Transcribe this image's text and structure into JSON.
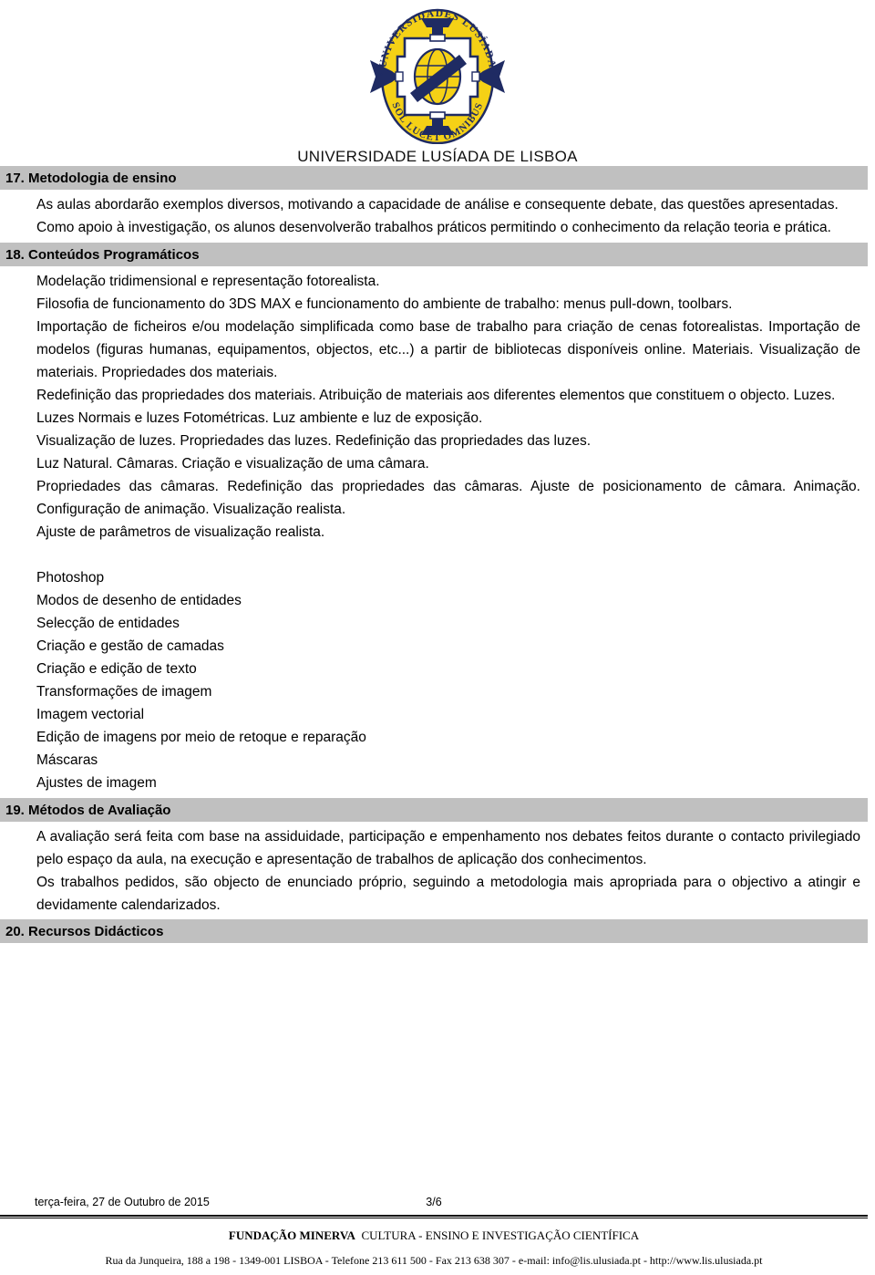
{
  "header": {
    "logo": {
      "icon": "university-seal-logo",
      "top_arc_text": "UNIVERSIDADES LUSÍADA",
      "bottom_arc_text": "SOL LUCET OMNIBUS",
      "ring_color": "#F5D116",
      "emblem_color": "#1F2B63"
    },
    "org_title": "UNIVERSIDADE LUSÍADA DE LISBOA"
  },
  "sections": [
    {
      "band_label": "17. Metodologia de ensino",
      "paragraphs": [
        "As aulas abordarão exemplos diversos, motivando a capacidade de análise e consequente debate, das questões apresentadas.",
        "Como apoio à investigação, os alunos desenvolverão trabalhos práticos permitindo o conhecimento da relação teoria e prática."
      ]
    },
    {
      "band_label": "18. Conteúdos Programáticos",
      "paragraphs": [
        "Modelação tridimensional e representação fotorealista.",
        "Filosofia de funcionamento do 3DS MAX e funcionamento do ambiente de trabalho: menus pull-down, toolbars.",
        "Importação de ficheiros e/ou modelação simplificada como base de trabalho para criação de cenas fotorealistas. Importação de modelos (figuras humanas, equipamentos, objectos, etc...) a partir de bibliotecas disponíveis online. Materiais. Visualização de materiais. Propriedades dos materiais.",
        "Redefinição das propriedades dos materiais. Atribuição de materiais aos diferentes elementos que constituem o objecto. Luzes.",
        "Luzes Normais e luzes Fotométricas. Luz ambiente e luz de exposição.",
        "Visualização de luzes. Propriedades das luzes. Redefinição das propriedades das luzes.",
        "Luz Natural. Câmaras. Criação e visualização de uma câmara.",
        "Propriedades das câmaras. Redefinição das propriedades das câmaras. Ajuste de posicionamento de câmara. Animação. Configuração de animação. Visualização realista.",
        "Ajuste de parâmetros de visualização realista."
      ],
      "list_items": [
        "Photoshop",
        "Modos de desenho de entidades",
        "Selecção de entidades",
        "Criação e gestão de camadas",
        "Criação e edição de texto",
        "Transformações de imagem",
        "Imagem vectorial",
        "Edição de imagens por meio de retoque e reparação",
        "Máscaras",
        "Ajustes de imagem"
      ]
    },
    {
      "band_label": "19. Métodos de Avaliação",
      "paragraphs": [
        "A avaliação será feita com base na assiduidade, participação e empenhamento nos debates feitos durante o contacto privilegiado pelo espaço da aula, na execução e apresentação de trabalhos de aplicação dos conhecimentos.",
        "Os trabalhos pedidos, são objecto de enunciado próprio, seguindo a metodologia mais apropriada para o objectivo a atingir e devidamente calendarizados."
      ]
    },
    {
      "band_label": "20. Recursos Didácticos",
      "paragraphs": []
    }
  ],
  "footer": {
    "date": "terça-feira, 27 de Outubro de 2015",
    "page": "3/6",
    "organisation_bold": "FUNDAÇÃO MINERVA",
    "organisation_rest": "CULTURA - ENSINO E INVESTIGAÇÃO CIENTÍFICA",
    "address": "Rua da Junqueira, 188 a 198 - 1349-001 LISBOA - Telefone 213 611 500 - Fax 213 638 307 - e-mail: info@lis.ulusiada.pt - http://www.lis.ulusiada.pt"
  }
}
